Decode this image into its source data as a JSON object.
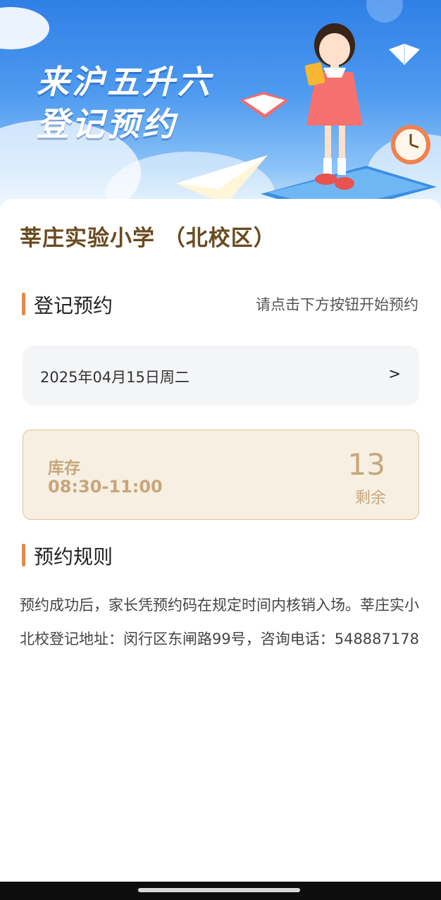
{
  "banner": {
    "title_line1": "来沪五升六",
    "title_line2": "登记预约"
  },
  "school": {
    "name": "莘庄实验小学 （北校区）"
  },
  "booking_section": {
    "title": "登记预约",
    "hint": "请点击下方按钮开始预约"
  },
  "date_picker": {
    "value": "2025年04月15日周二",
    "arrow": ">"
  },
  "slot": {
    "label": "库存",
    "time": "08:30-11:00",
    "count": "13",
    "remain_label": "剩余"
  },
  "rules_section": {
    "title": "预约规则",
    "text": "预约成功后，家长凭预约码在规定时间内核销入场。莘庄实小北校登记地址：闵行区东闸路99号，咨询电话：548887178"
  },
  "colors": {
    "accent": "#e08a4b",
    "school_title": "#6a4a1f",
    "slot_text": "#c7a67a",
    "slot_bg": "#f7efe2"
  }
}
